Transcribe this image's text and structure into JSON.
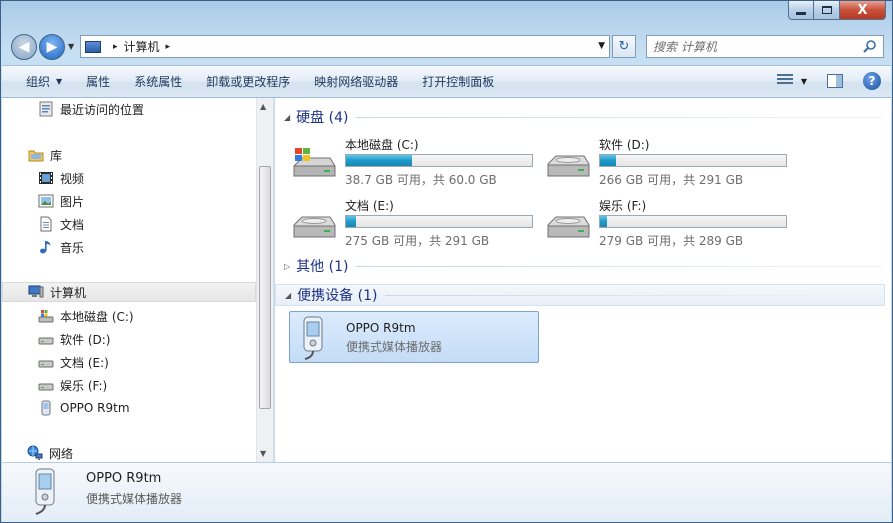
{
  "window": {
    "close_label": "X",
    "colors": {
      "accent": "#1e3287",
      "bar_fill": "#1e9ac8",
      "selection": "#c3dcf6"
    }
  },
  "address_bar": {
    "root_icon": "computer-icon",
    "crumbs": [
      "计算机"
    ],
    "separator": "▸"
  },
  "search": {
    "placeholder": "搜索 计算机"
  },
  "toolbar": {
    "organize": "组织",
    "properties": "属性",
    "system_properties": "系统属性",
    "uninstall": "卸载或更改程序",
    "map_drive": "映射网络驱动器",
    "control_panel": "打开控制面板",
    "help": "?"
  },
  "nav": {
    "recent": "最近访问的位置",
    "libraries": "库",
    "videos": "视频",
    "pictures": "图片",
    "documents": "文档",
    "music": "音乐",
    "computer": "计算机",
    "drive_c": "本地磁盘 (C:)",
    "drive_d": "软件 (D:)",
    "drive_e": "文档 (E:)",
    "drive_f": "娱乐 (F:)",
    "phone": "OPPO R9tm",
    "network": "网络"
  },
  "groups": {
    "hard_disks": "硬盘 (4)",
    "other": "其他 (1)",
    "portable": "便携设备 (1)"
  },
  "drives": [
    {
      "name": "本地磁盘 (C:)",
      "size": "38.7 GB 可用，共 60.0 GB",
      "used_fraction": 0.355
    },
    {
      "name": "软件 (D:)",
      "size": "266 GB 可用，共 291 GB",
      "used_fraction": 0.086
    },
    {
      "name": "文档 (E:)",
      "size": "275 GB 可用，共 291 GB",
      "used_fraction": 0.055
    },
    {
      "name": "娱乐 (F:)",
      "size": "279 GB 可用，共 289 GB",
      "used_fraction": 0.035
    }
  ],
  "device": {
    "name": "OPPO R9tm",
    "type": "便携式媒体播放器"
  },
  "details": {
    "name": "OPPO R9tm",
    "type": "便携式媒体播放器"
  }
}
